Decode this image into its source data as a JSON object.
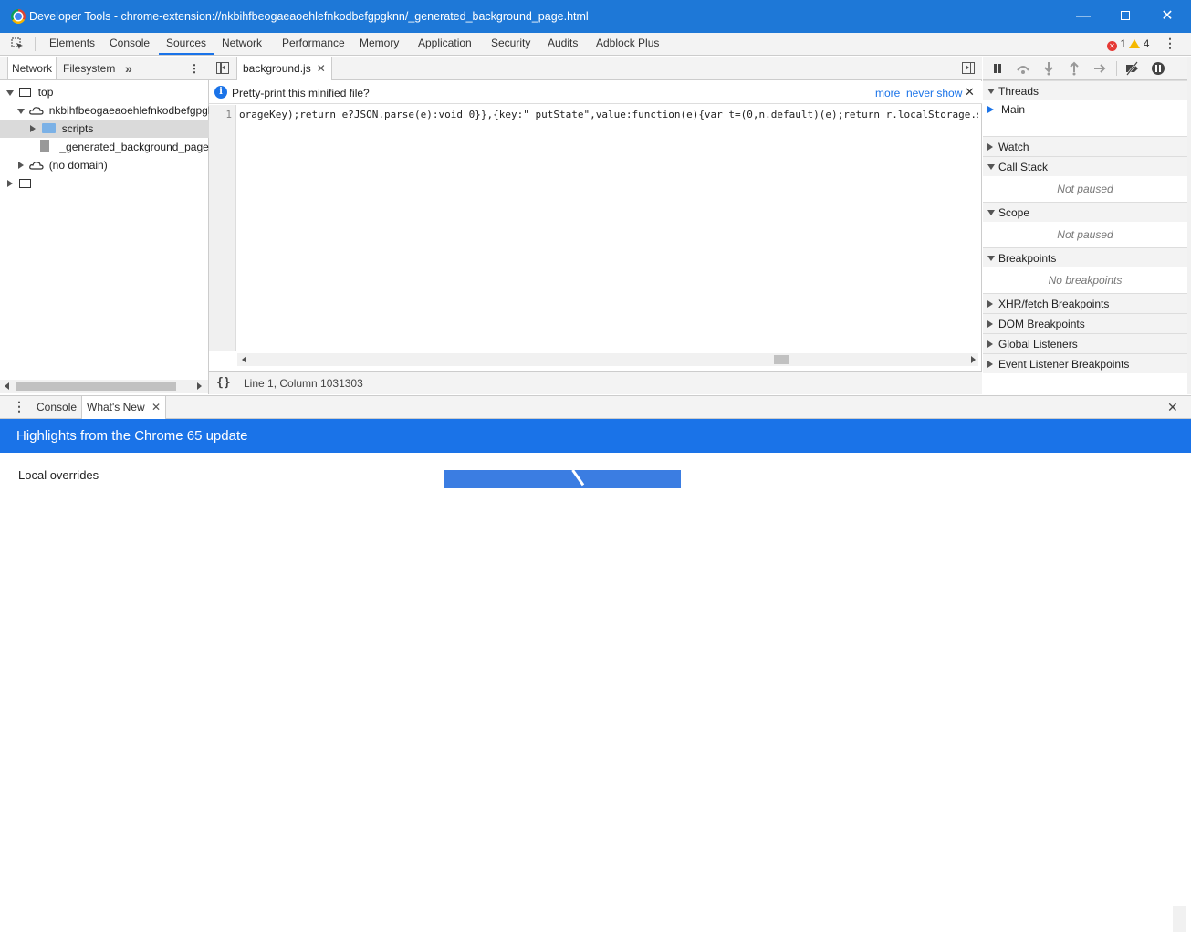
{
  "window": {
    "title": "Developer Tools - chrome-extension://nkbihfbeogaeaoehlefnkodbefgpgknn/_generated_background_page.html",
    "controls": {
      "minimize": "—",
      "close": "✕"
    }
  },
  "main_tabs": [
    "Elements",
    "Console",
    "Sources",
    "Network",
    "Performance",
    "Memory",
    "Application",
    "Security",
    "Audits",
    "Adblock Plus"
  ],
  "active_main_tab": "Sources",
  "status": {
    "errors": "1",
    "warnings": "4"
  },
  "navigator": {
    "tabs": [
      "Network",
      "Filesystem"
    ],
    "more": "»",
    "tree": {
      "top": "top",
      "extension": "nkbihfbeogaeaoehlefnkodbefgpgknn",
      "scripts": "scripts",
      "page": "_generated_background_page.html",
      "no_domain": "(no domain)"
    }
  },
  "editor": {
    "file_tab": "background.js",
    "info": {
      "message": "Pretty-print this minified file?",
      "more": "more",
      "never_show": "never show",
      "icon": "i",
      "close": "✕"
    },
    "line_number": "1",
    "code": "orageKey);return e?JSON.parse(e):void 0}},{key:\"_putState\",value:function(e){var t=(0,n.default)(e);return r.localStorage.se",
    "braces": "{}",
    "status": "Line 1, Column 1031303"
  },
  "debugger": {
    "threads": "Threads",
    "main_thread": "Main",
    "watch": "Watch",
    "call_stack": "Call Stack",
    "call_stack_body": "Not paused",
    "scope": "Scope",
    "scope_body": "Not paused",
    "breakpoints": "Breakpoints",
    "breakpoints_body": "No breakpoints",
    "xhr_breakpoints": "XHR/fetch Breakpoints",
    "dom_breakpoints": "DOM Breakpoints",
    "global_listeners": "Global Listeners",
    "event_listener_breakpoints": "Event Listener Breakpoints"
  },
  "drawer": {
    "tabs": [
      "Console",
      "What's New"
    ],
    "close": "✕",
    "banner": "Highlights from the Chrome 65 update",
    "heading": "Local overrides"
  }
}
